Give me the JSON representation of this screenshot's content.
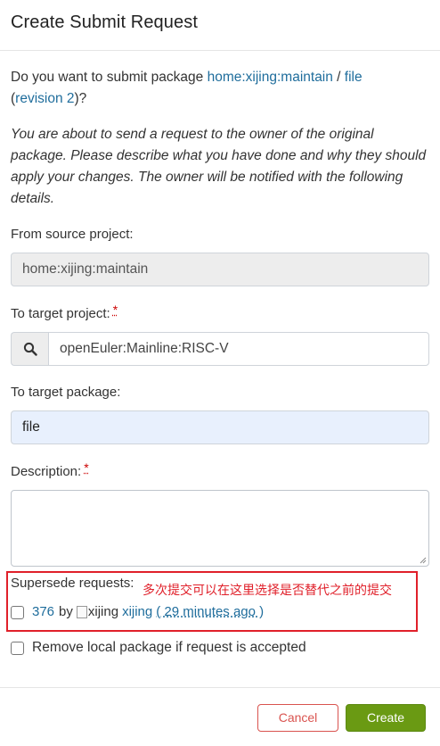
{
  "dialog": {
    "title": "Create Submit Request"
  },
  "question": {
    "prefix": "Do you want to submit package ",
    "project_link": "home:xijing:maintain",
    "sep": " / ",
    "package_link": "file",
    "open_paren": "(",
    "revision_link": "revision 2",
    "close": ")?"
  },
  "intro": "You are about to send a request to the owner of the original package. Please describe what you have done and why they should apply your changes. The owner will be notified with the following details.",
  "source": {
    "label": "From source project:",
    "value": "home:xijing:maintain"
  },
  "target_project": {
    "label": "To target project:",
    "required": "*",
    "value": "openEuler:Mainline:RISC-V",
    "search_icon": "search-icon"
  },
  "target_package": {
    "label": "To target package:",
    "value": "file"
  },
  "description": {
    "label": "Description:",
    "required": "*",
    "value": ""
  },
  "supersede": {
    "label": "Supersede requests:",
    "annotation": "多次提交可以在这里选择是否替代之前的提交",
    "annotation_color": "#e0202a",
    "request_id": "376",
    "by": "by",
    "user_alt": "xijing",
    "user_link": "xijing",
    "time": "( 29 minutes ago )",
    "checked": false
  },
  "remove_local": {
    "label": "Remove local package if request is accepted",
    "checked": false
  },
  "footer": {
    "cancel": "Cancel",
    "create": "Create"
  },
  "colors": {
    "link": "#1f6d9c",
    "create_bg": "#6a9a13",
    "cancel": "#d9534f"
  }
}
